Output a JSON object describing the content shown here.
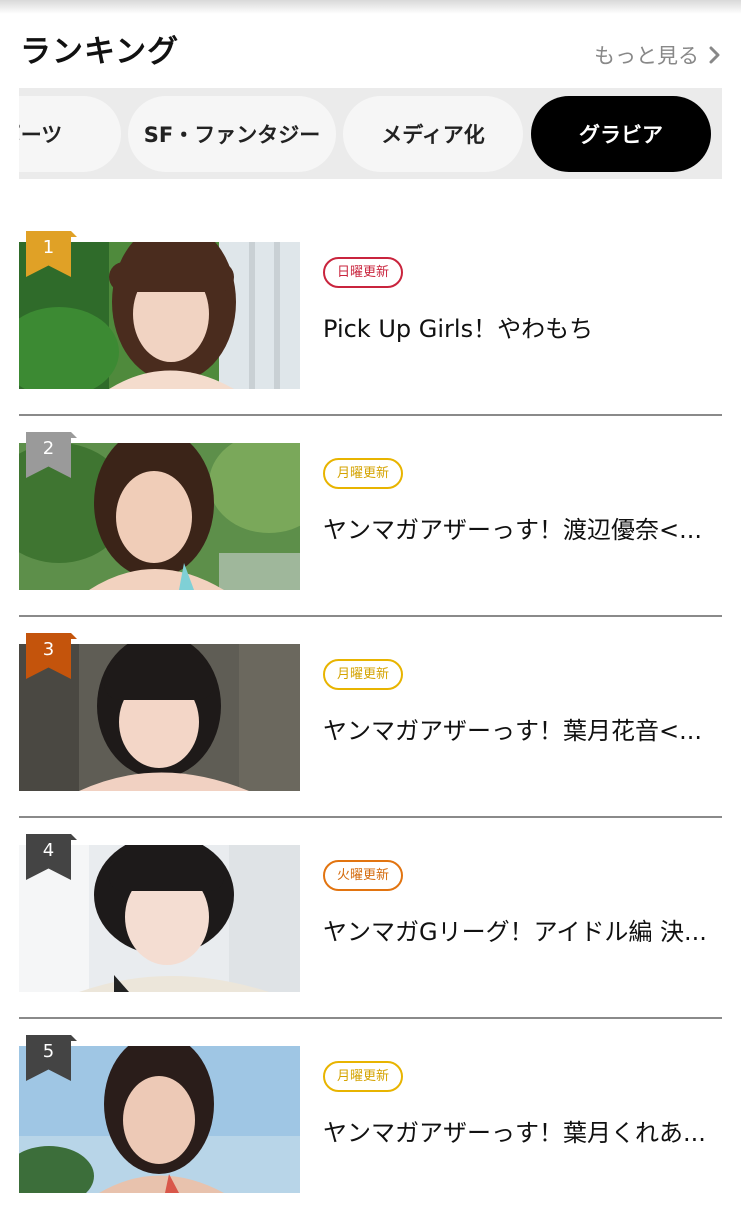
{
  "header": {
    "title": "ランキング",
    "see_more": "もっと見る"
  },
  "tabs": [
    {
      "label": "ポーツ",
      "active": false
    },
    {
      "label": "SF・ファンタジー",
      "active": false
    },
    {
      "label": "メディア化",
      "active": false
    },
    {
      "label": "グラビア",
      "active": true
    }
  ],
  "ranking": [
    {
      "rank": "1",
      "day": "日曜更新",
      "title": "Pick Up Girls！やわもち",
      "badge_color": "#e0a126",
      "day_color": "red"
    },
    {
      "rank": "2",
      "day": "月曜更新",
      "title": "ヤンマガアザーっす！渡辺優奈<...",
      "badge_color": "#9a9a9a",
      "day_color": "yellow"
    },
    {
      "rank": "3",
      "day": "月曜更新",
      "title": "ヤンマガアザーっす！葉月花音<...",
      "badge_color": "#c4540c",
      "day_color": "yellow"
    },
    {
      "rank": "4",
      "day": "火曜更新",
      "title": "ヤンマガGリーグ！アイドル編 決...",
      "badge_color": "#444444",
      "day_color": "orange"
    },
    {
      "rank": "5",
      "day": "月曜更新",
      "title": "ヤンマガアザーっす！葉月くれあ...",
      "badge_color": "#444444",
      "day_color": "yellow"
    }
  ]
}
